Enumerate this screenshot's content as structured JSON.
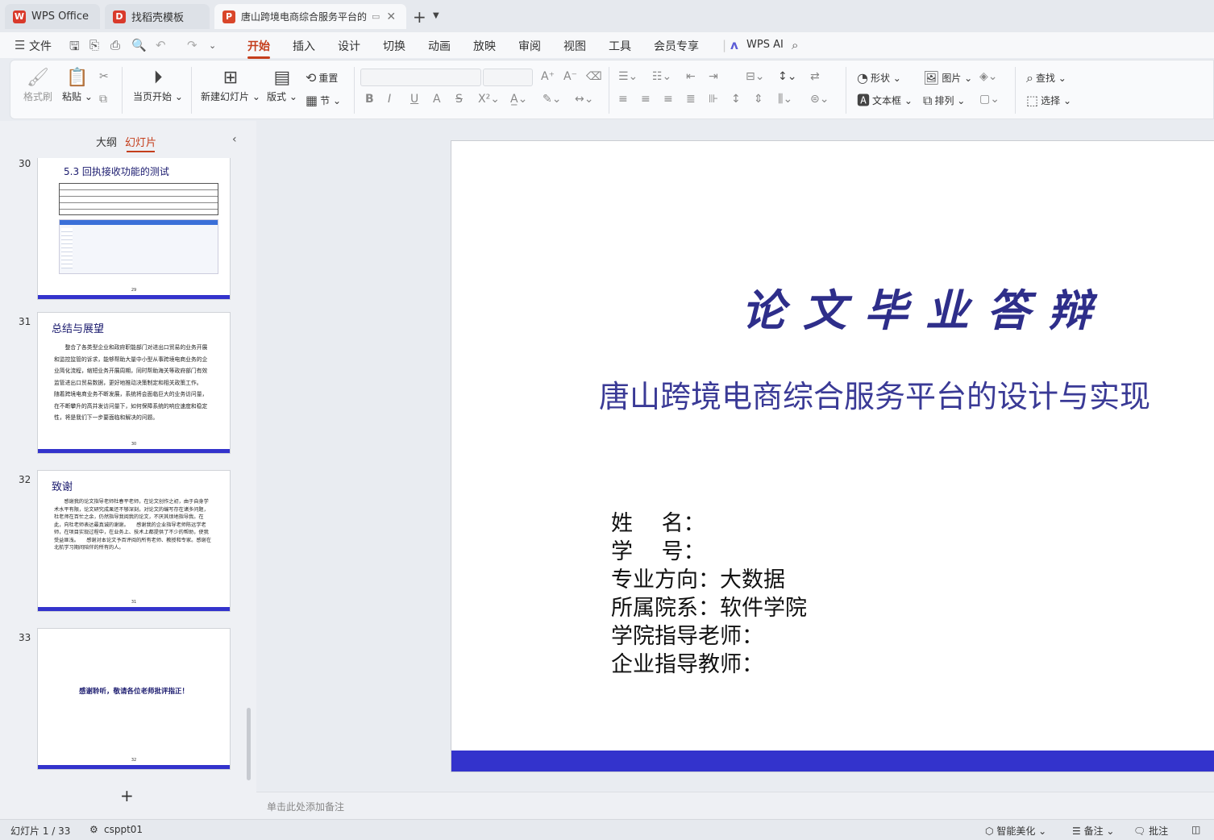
{
  "titlebar": {
    "tabs": [
      {
        "label": "WPS Office",
        "badge": "W",
        "color": "#d93a2b"
      },
      {
        "label": "找稻壳模板",
        "badge": "D",
        "color": "#d93a2b"
      },
      {
        "label": "唐山跨境电商综合服务平台的",
        "badge": "P",
        "color": "#d9462a"
      }
    ],
    "new_tab": "+",
    "tab_list": "⌄"
  },
  "menubar": {
    "file": "文件",
    "items": [
      "开始",
      "插入",
      "设计",
      "切换",
      "动画",
      "放映",
      "审阅",
      "视图",
      "工具",
      "会员专享"
    ],
    "active": "开始",
    "wps_ai": "WPS AI"
  },
  "ribbon": {
    "format_painter": "格式刷",
    "paste": "粘贴",
    "from_current": "当页开始",
    "new_slide": "新建幻灯片",
    "layout": "版式",
    "reset": "重置",
    "section": "节",
    "shape": "形状",
    "picture": "图片",
    "textbox": "文本框",
    "arrange": "排列",
    "find": "查找",
    "select": "选择"
  },
  "leftpanel": {
    "tab_outline": "大纲",
    "tab_slides": "幻灯片",
    "thumbs": [
      {
        "num": "30",
        "title": "5.3  回执接收功能的测试",
        "page": "29"
      },
      {
        "num": "31",
        "title": "总结与展望",
        "page": "30",
        "body": "　　整合了各类型企业和政府职能部门对进出口贸易的业务开展和监控监管的诉求，能够帮助大量中小型从事跨境电商业务的企业简化流程，缩短业务开展周期，同时帮助海关等政府部门有效监管进出口贸易数据，更好地推动决策制定和相关政策工作。　　随着跨境电商业务不断发展，系统将会面临巨大的业务访问量，在不断攀升的高并发访问量下，如何保障系统的响应速度和稳定性，将是我们下一步要面临和解决的问题。"
      },
      {
        "num": "32",
        "title": "致谢",
        "page": "31",
        "body": "　　感谢我的论文指导老师杜春平老师，在论文创作之初，由于自身学术水平有限，论文研究成果还不够深刻，对论文的编写存在诸多问题，杜老师在百忙之余，仍然指导我阅我的论文，不厌其烦地指导我。在此，向杜老师表达最真诚的谢谢。　　感谢我的企业指导老师陈远学老师，在项目实现过程中，在业务上、技术上都提供了不少的帮助，使我受益匪浅。　　感谢对本论文予百评阅的所有老师、教授和专家。感谢在北航学习期间陪伴的所有的人。"
      },
      {
        "num": "33",
        "title": "",
        "page": "32",
        "body": "感谢聆听，敬请各位老师批评指正！"
      }
    ],
    "add": "+"
  },
  "slide": {
    "title": "论文毕业答辩",
    "subtitle": "唐山跨境电商综合服务平台的设计与实现",
    "info": [
      "姓　 名：",
      "学　 号：",
      "专业方向：大数据",
      "所属院系：软件学院",
      "学院指导老师：",
      "企业指导教师："
    ]
  },
  "notes": {
    "placeholder": "单击此处添加备注"
  },
  "statusbar": {
    "slide_counter": "幻灯片 1 / 33",
    "theme": "csppt01",
    "beautify": "智能美化",
    "notes": "备注",
    "comments": "批注"
  },
  "colors": {
    "accent": "#c43e1c",
    "slide_bar": "#3333cc",
    "title": "#2e2e8a"
  }
}
